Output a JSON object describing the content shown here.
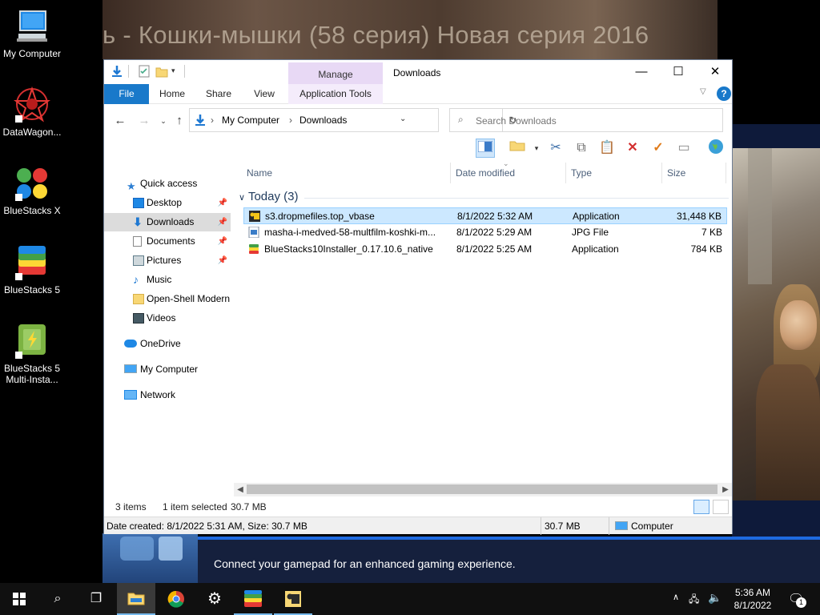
{
  "background": {
    "video_title": "ь - Кошки-мышки (58 серия) Новая серия 2016"
  },
  "gamepad_notification": {
    "message": "Connect your gamepad for an enhanced gaming experience."
  },
  "desktop_icons": [
    {
      "label": "My Computer",
      "icon": "computer-icon"
    },
    {
      "label": "DataWagon...",
      "icon": "datawagon-icon"
    },
    {
      "label": "BlueStacks X",
      "icon": "bluestacks-x-icon"
    },
    {
      "label": "BlueStacks 5",
      "icon": "bluestacks-5-icon"
    },
    {
      "label": "BlueStacks 5 Multi-Insta...",
      "icon": "bluestacks-multi-instance-icon"
    }
  ],
  "window": {
    "title": "Downloads",
    "manage_label": "Manage",
    "controls": {
      "minimize": "—",
      "maximize": "☐",
      "close": "✕"
    }
  },
  "ribbon": {
    "tabs": [
      "File",
      "Home",
      "Share",
      "View",
      "Application Tools"
    ],
    "help": "?"
  },
  "address": {
    "segments": [
      "My Computer",
      "Downloads"
    ],
    "search_placeholder": "Search Downloads"
  },
  "nav_pane": {
    "items": [
      {
        "label": "Quick access",
        "icon": "star-icon"
      },
      {
        "label": "Desktop",
        "icon": "desktop-icon",
        "pinned": true
      },
      {
        "label": "Downloads",
        "icon": "download-icon",
        "pinned": true,
        "selected": true
      },
      {
        "label": "Documents",
        "icon": "documents-icon",
        "pinned": true
      },
      {
        "label": "Pictures",
        "icon": "pictures-icon",
        "pinned": true
      },
      {
        "label": "Music",
        "icon": "music-icon"
      },
      {
        "label": "Open-Shell Modern",
        "icon": "folder-icon"
      },
      {
        "label": "Videos",
        "icon": "videos-icon"
      },
      {
        "label": "OneDrive",
        "icon": "cloud-icon"
      },
      {
        "label": "My Computer",
        "icon": "computer-icon"
      },
      {
        "label": "Network",
        "icon": "network-icon"
      }
    ]
  },
  "columns": {
    "name": "Name",
    "date": "Date modified",
    "type": "Type",
    "size": "Size"
  },
  "group": {
    "label": "Today (3)"
  },
  "files": [
    {
      "name": "s3.dropmefiles.top_vbase",
      "date": "8/1/2022 5:32 AM",
      "type": "Application",
      "size": "31,448 KB",
      "selected": true
    },
    {
      "name": "masha-i-medved-58-multfilm-koshki-m...",
      "date": "8/1/2022 5:29 AM",
      "type": "JPG File",
      "size": "7 KB"
    },
    {
      "name": "BlueStacks10Installer_0.17.10.6_native",
      "date": "8/1/2022 5:25 AM",
      "type": "Application",
      "size": "784 KB"
    }
  ],
  "status": {
    "items": "3 items",
    "selected": "1 item selected",
    "size": "30.7 MB"
  },
  "details": {
    "text": "Date created: 8/1/2022 5:31 AM, Size: 30.7 MB",
    "size": "30.7 MB",
    "location": "Computer"
  },
  "taskbar": {
    "time": "5:36 AM",
    "date": "8/1/2022",
    "notification_count": "1"
  }
}
